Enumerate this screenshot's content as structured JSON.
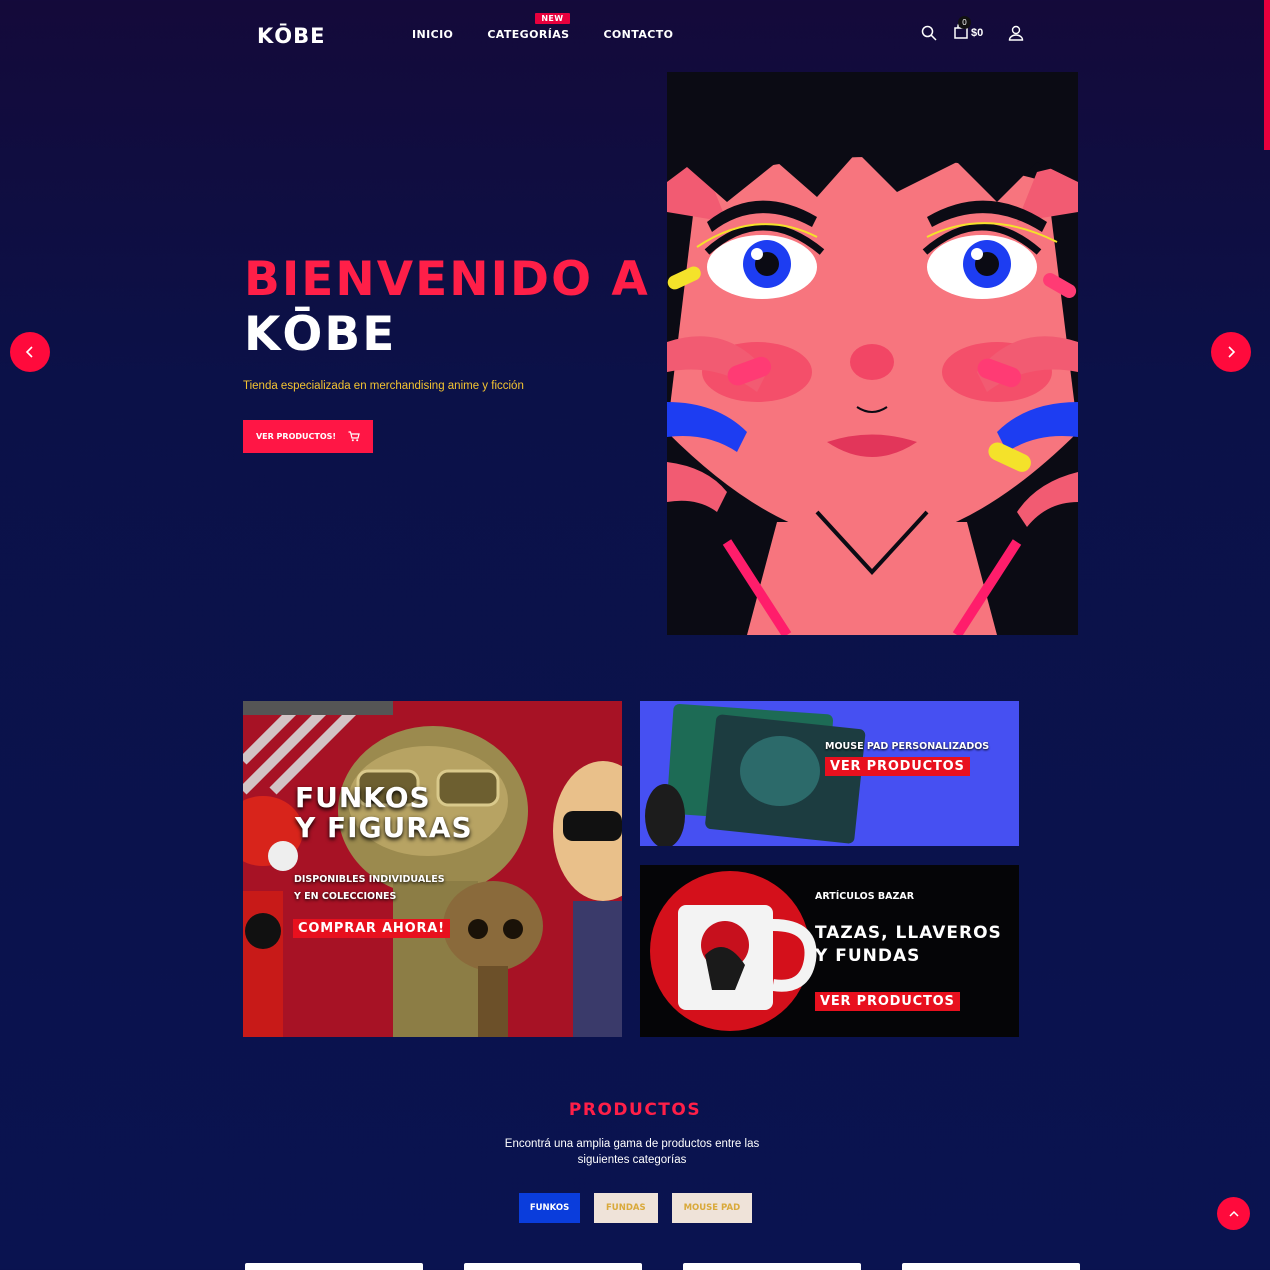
{
  "header": {
    "logo": "KŌBE",
    "nav": [
      {
        "label": "INICIO"
      },
      {
        "label": "CATEGORÍAS",
        "badge": "NEW"
      },
      {
        "label": "CONTACTO"
      }
    ],
    "cart_count": "0",
    "cart_total": "$0",
    "icons": [
      "search-icon",
      "shopping-bag-icon",
      "user-icon"
    ]
  },
  "hero": {
    "title_line1": "BIENVENIDO A",
    "title_line2": "KŌBE",
    "subtitle": "Tienda especializada en merchandising anime y ficción",
    "button_label": "VER PRODUCTOS!",
    "button_icon": "cart-icon"
  },
  "banners": {
    "funkos": {
      "title_line1": "FUNKOS",
      "title_line2": "Y FIGURAS",
      "sub_line1": "DISPONIBLES INDIVIDUALES",
      "sub_line2": "Y EN COLECCIONES",
      "cta": "COMPRAR AHORA!"
    },
    "mousepad": {
      "title": "MOUSE PAD PERSONALIZADOS",
      "cta": "VER PRODUCTOS"
    },
    "bazar": {
      "eyebrow": "ARTÍCULOS BAZAR",
      "title_line1": "TAZAS, LLAVEROS",
      "title_line2": "Y FUNDAS",
      "cta": "VER PRODUCTOS"
    }
  },
  "products": {
    "title": "PRODUCTOS",
    "subtitle": "Encontrá una amplia gama de productos entre las siguientes categorías",
    "filters": [
      "FUNKOS",
      "FUNDAS",
      "MOUSE PAD"
    ],
    "active_filter": "FUNKOS"
  },
  "colors": {
    "accent": "#ff1645",
    "background": "#0a1350",
    "highlight": "#f4c431",
    "filter_active": "#0a3ddc"
  }
}
